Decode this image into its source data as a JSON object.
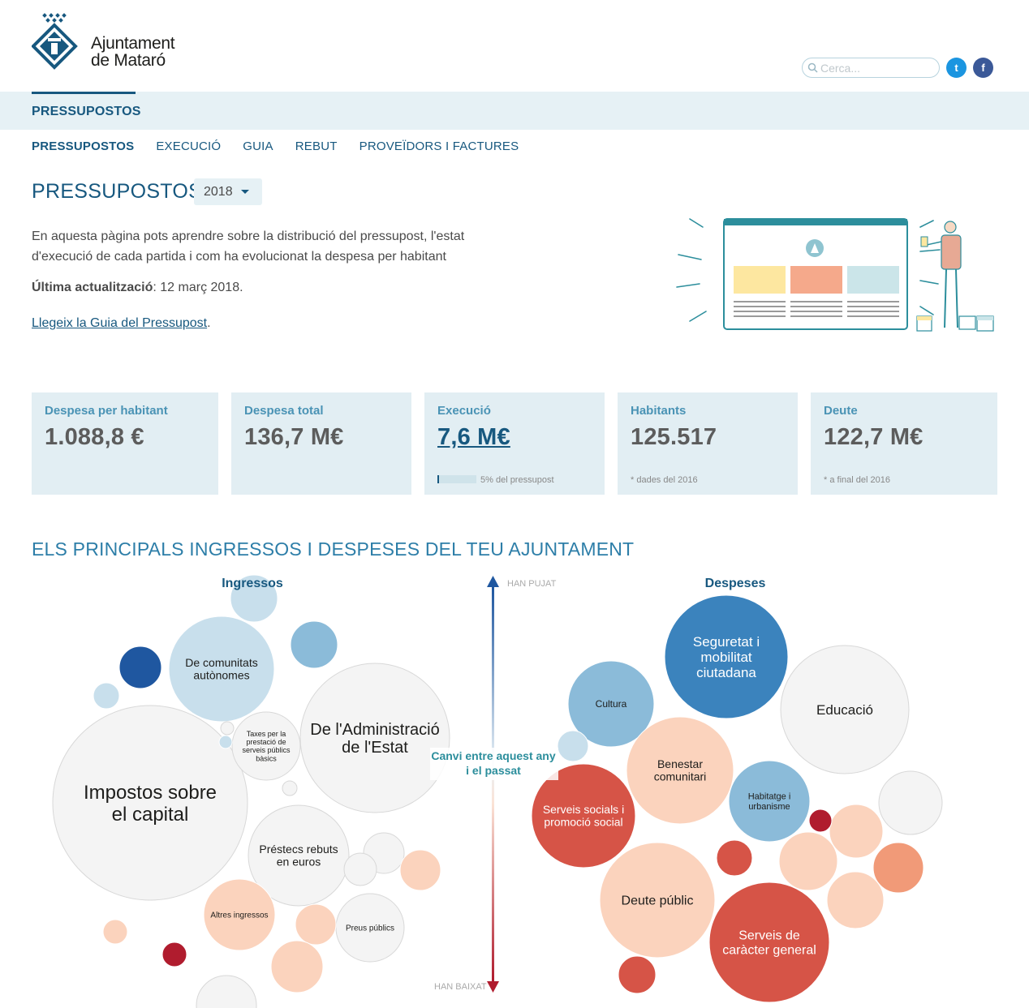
{
  "header": {
    "logo_text_line1": "Ajuntament",
    "logo_text_line2": "de Mataró",
    "search_placeholder": "Cerca...",
    "twitter": "t",
    "facebook": "f"
  },
  "section": {
    "title": "PRESSUPOSTOS"
  },
  "subnav": [
    {
      "label": "PRESSUPOSTOS",
      "active": true
    },
    {
      "label": "EXECUCIÓ"
    },
    {
      "label": "GUIA"
    },
    {
      "label": "REBUT"
    },
    {
      "label": "PROVEÏDORS I FACTURES"
    }
  ],
  "page": {
    "title": "PRESSUPOSTOS",
    "year": "2018",
    "intro": "En aquesta pàgina pots aprendre sobre la distribució del pressupost, l'estat d'execució de cada partida i com ha evolucionat la despesa per habitant",
    "updated_label": "Última actualització",
    "updated_value": ": 12 març 2018.",
    "guide_link": "Llegeix la Guia del Pressupost"
  },
  "cards": [
    {
      "label": "Despesa per habitant",
      "value": "1.088,8 €",
      "note": ""
    },
    {
      "label": "Despesa total",
      "value": "136,7 M€",
      "note": ""
    },
    {
      "label": "Execució",
      "value": "7,6 M€",
      "note": "5% del pressupost",
      "progress": 0.05
    },
    {
      "label": "Habitants",
      "value": "125.517",
      "note": "* dades del 2016"
    },
    {
      "label": "Deute",
      "value": "122,7 M€",
      "note": "* a final del 2016"
    }
  ],
  "chart_section_title": "ELS PRINCIPALS INGRESSOS I DESPESES DEL TEU AJUNTAMENT",
  "chart_data": {
    "type": "bubble",
    "income_title": "Ingressos",
    "expense_title": "Despeses",
    "axis_top": "HAN PUJAT",
    "axis_bottom": "HAN BAIXAT",
    "axis_label_line1": "Canvi entre aquest any",
    "axis_label_line2": "i el passat",
    "labels": {
      "impostos": [
        "Impostos sobre",
        "el capital"
      ],
      "estat": [
        "De l'Administració",
        "de l'Estat"
      ],
      "autonomes": [
        "De comunitats",
        "autònomes"
      ],
      "prestecs": [
        "Préstecs rebuts",
        "en euros"
      ],
      "taxes": [
        "Taxes per la",
        "prestació de",
        "serveis públics",
        "bàsics"
      ],
      "altres": [
        "Altres ingressos"
      ],
      "preus": [
        "Preus públics"
      ],
      "seguretat": [
        "Seguretat i",
        "mobilitat",
        "ciutadana"
      ],
      "cultura": [
        "Cultura"
      ],
      "educacio": [
        "Educació"
      ],
      "benestar": [
        "Benestar",
        "comunitari"
      ],
      "habitatge": [
        "Habitatge i",
        "urbanisme"
      ],
      "socials": [
        "Serveis socials i",
        "promoció social"
      ],
      "deute": [
        "Deute públic"
      ],
      "general": [
        "Serveis de",
        "caràcter general"
      ]
    },
    "colors": {
      "strong_up": "#1f57a0",
      "up": "#3b83bd",
      "mild_up": "#8bbbd9",
      "slight_up": "#c8dfec",
      "neutral": "#f4f4f4",
      "slight_down": "#fbd3bd",
      "down": "#f19a78",
      "strong_down": "#d65447",
      "very_down": "#b01c2e"
    }
  }
}
